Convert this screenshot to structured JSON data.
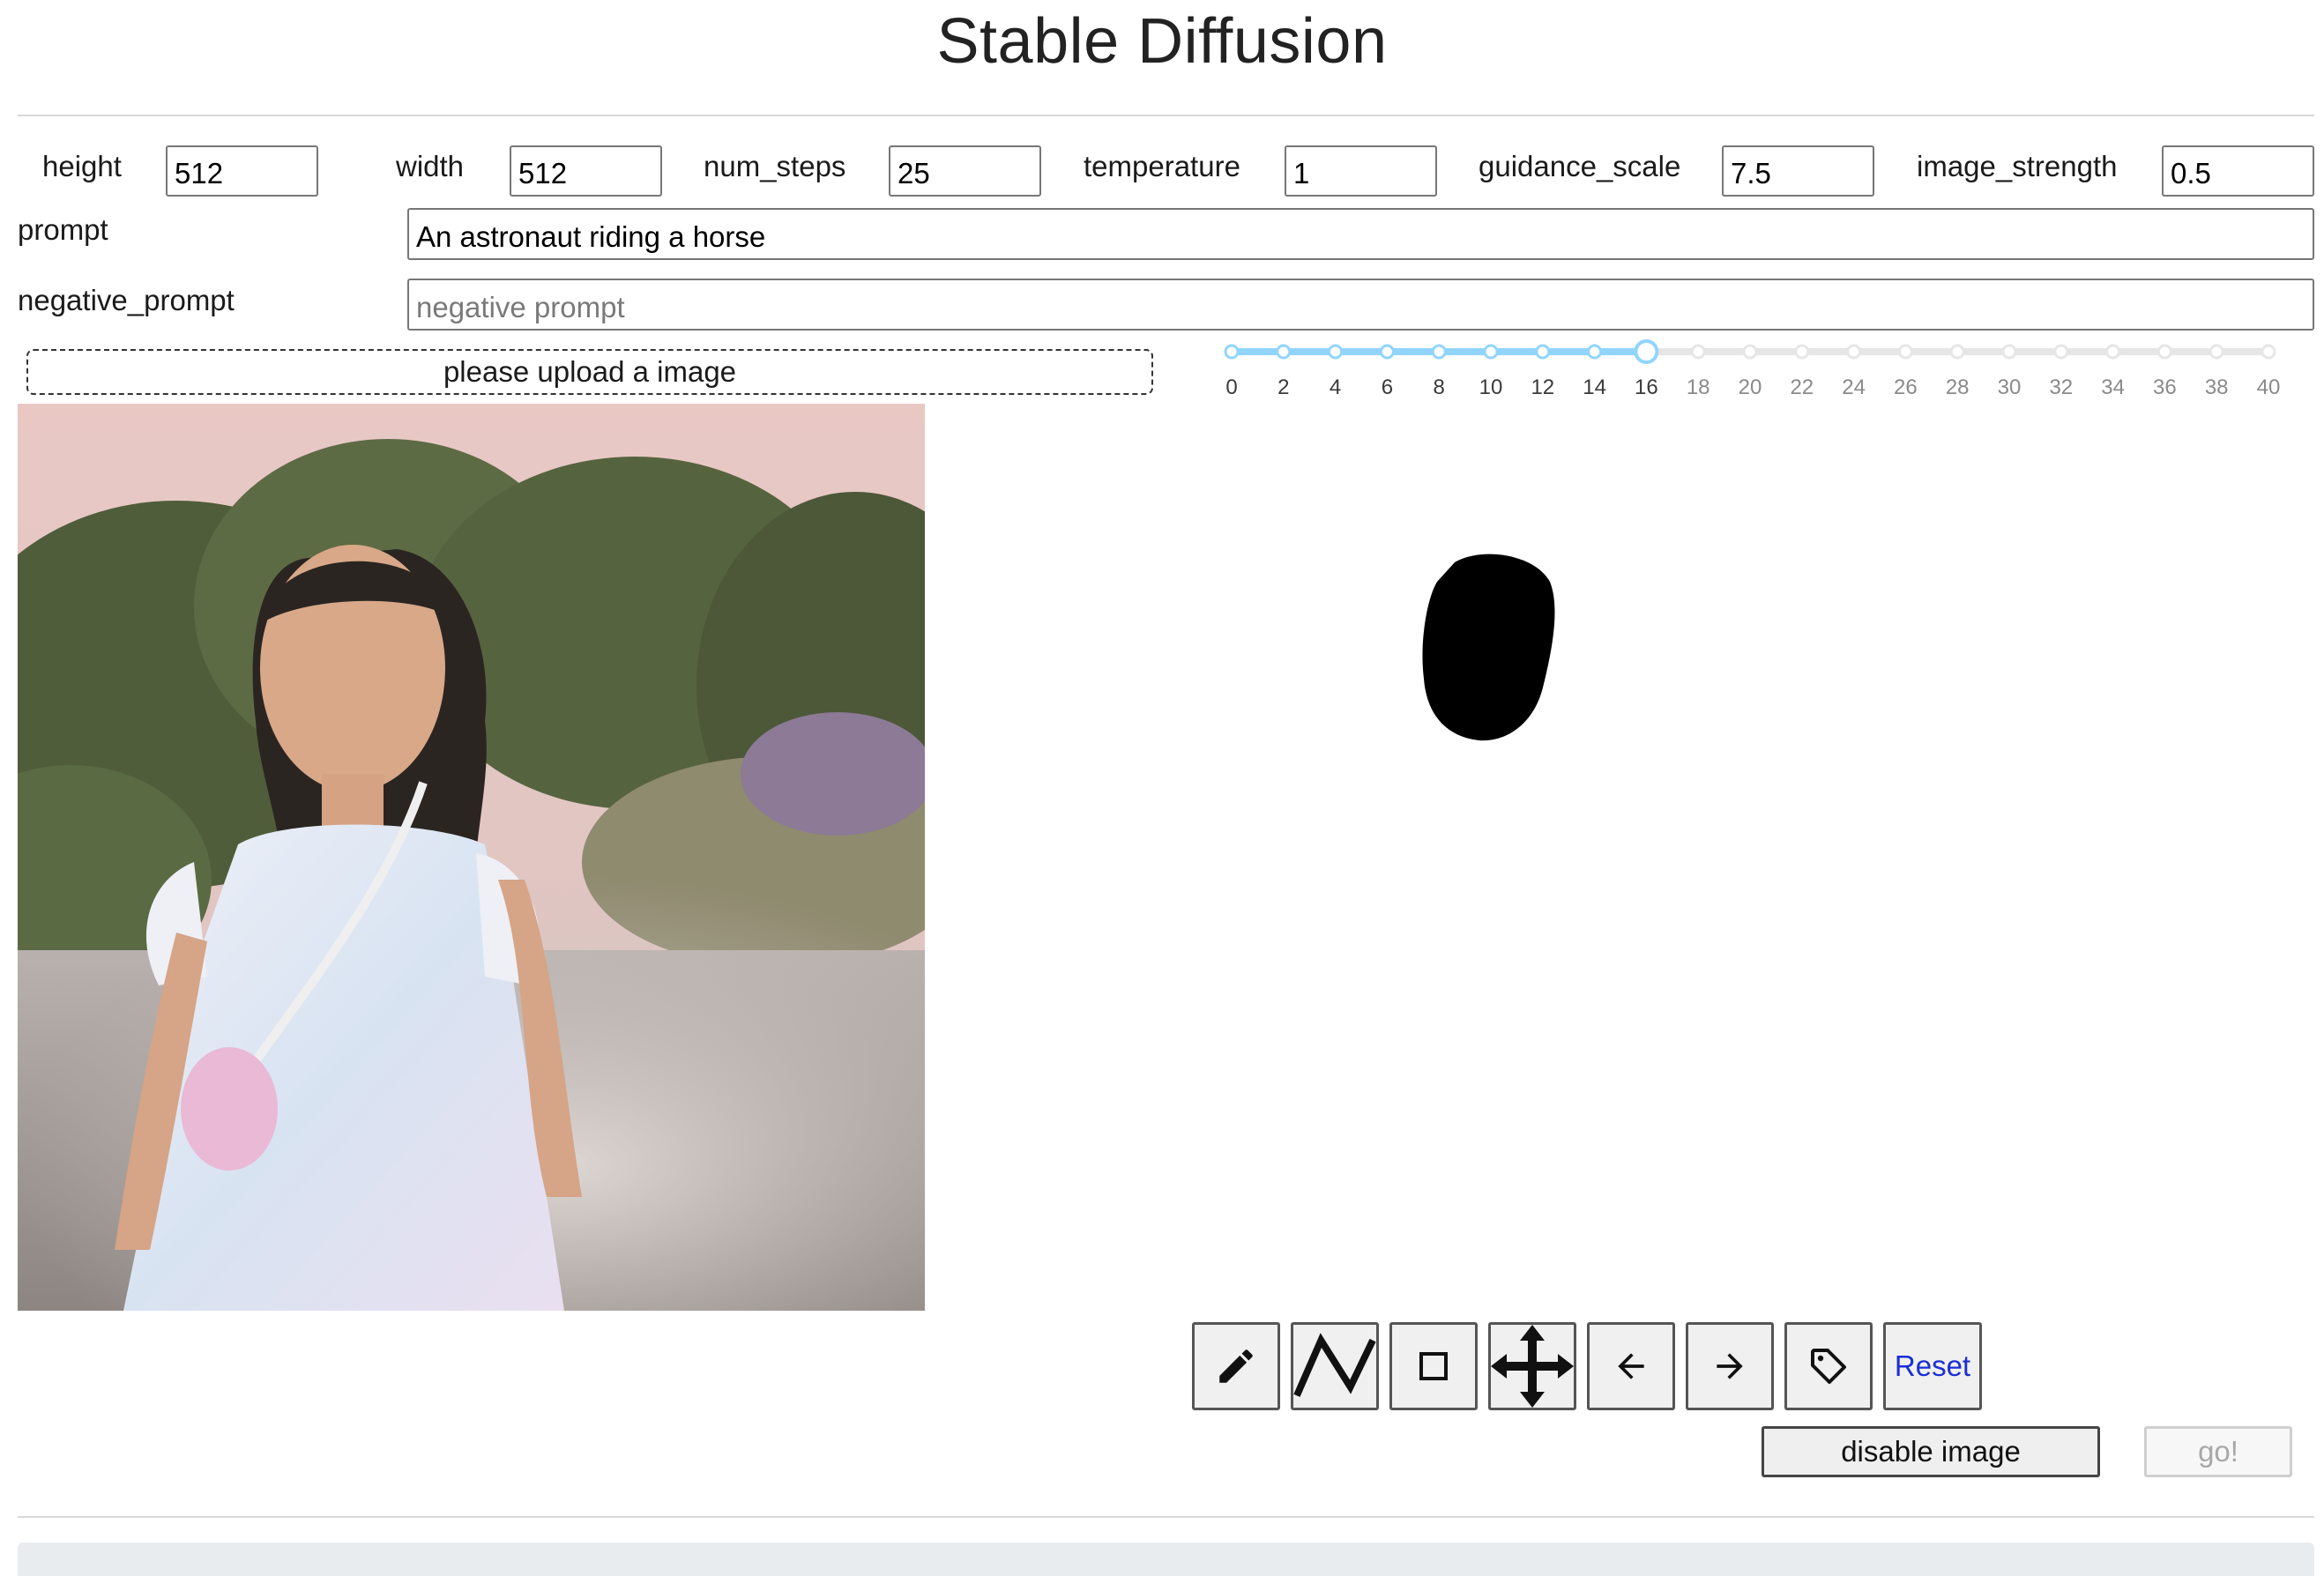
{
  "header": {
    "title": "Stable Diffusion"
  },
  "params": [
    {
      "label": "height",
      "value": "512"
    },
    {
      "label": "width",
      "value": "512"
    },
    {
      "label": "num_steps",
      "value": "25"
    },
    {
      "label": "temperature",
      "value": "1"
    },
    {
      "label": "guidance_scale",
      "value": "7.5"
    },
    {
      "label": "image_strength",
      "value": "0.5"
    }
  ],
  "prompt": {
    "label": "prompt",
    "value": "An astronaut riding a horse"
  },
  "negative_prompt": {
    "label": "negative_prompt",
    "value": "",
    "placeholder": "negative prompt"
  },
  "upload": {
    "label": "please upload a image"
  },
  "slider": {
    "min": 0,
    "max": 40,
    "step": 2,
    "value": 16,
    "tick_labels": [
      "0",
      "2",
      "4",
      "6",
      "8",
      "10",
      "12",
      "14",
      "16",
      "18",
      "20",
      "22",
      "24",
      "26",
      "28",
      "30",
      "32",
      "34",
      "36",
      "38",
      "40"
    ],
    "active_color": "#91d5ff",
    "inactive_color": "#e6e6e6"
  },
  "toolbar": {
    "tools": [
      {
        "name": "pencil-icon"
      },
      {
        "name": "polyline-icon"
      },
      {
        "name": "rectangle-icon"
      },
      {
        "name": "move-icon"
      },
      {
        "name": "undo-arrow-icon"
      },
      {
        "name": "redo-arrow-icon"
      },
      {
        "name": "tag-icon"
      }
    ],
    "reset_label": "Reset"
  },
  "actions": {
    "disable_image_label": "disable image",
    "go_label": "go!"
  },
  "colors": {
    "link_blue": "#1a2fd6",
    "divider": "#d8d8d8",
    "footer": "#e9ecef"
  }
}
